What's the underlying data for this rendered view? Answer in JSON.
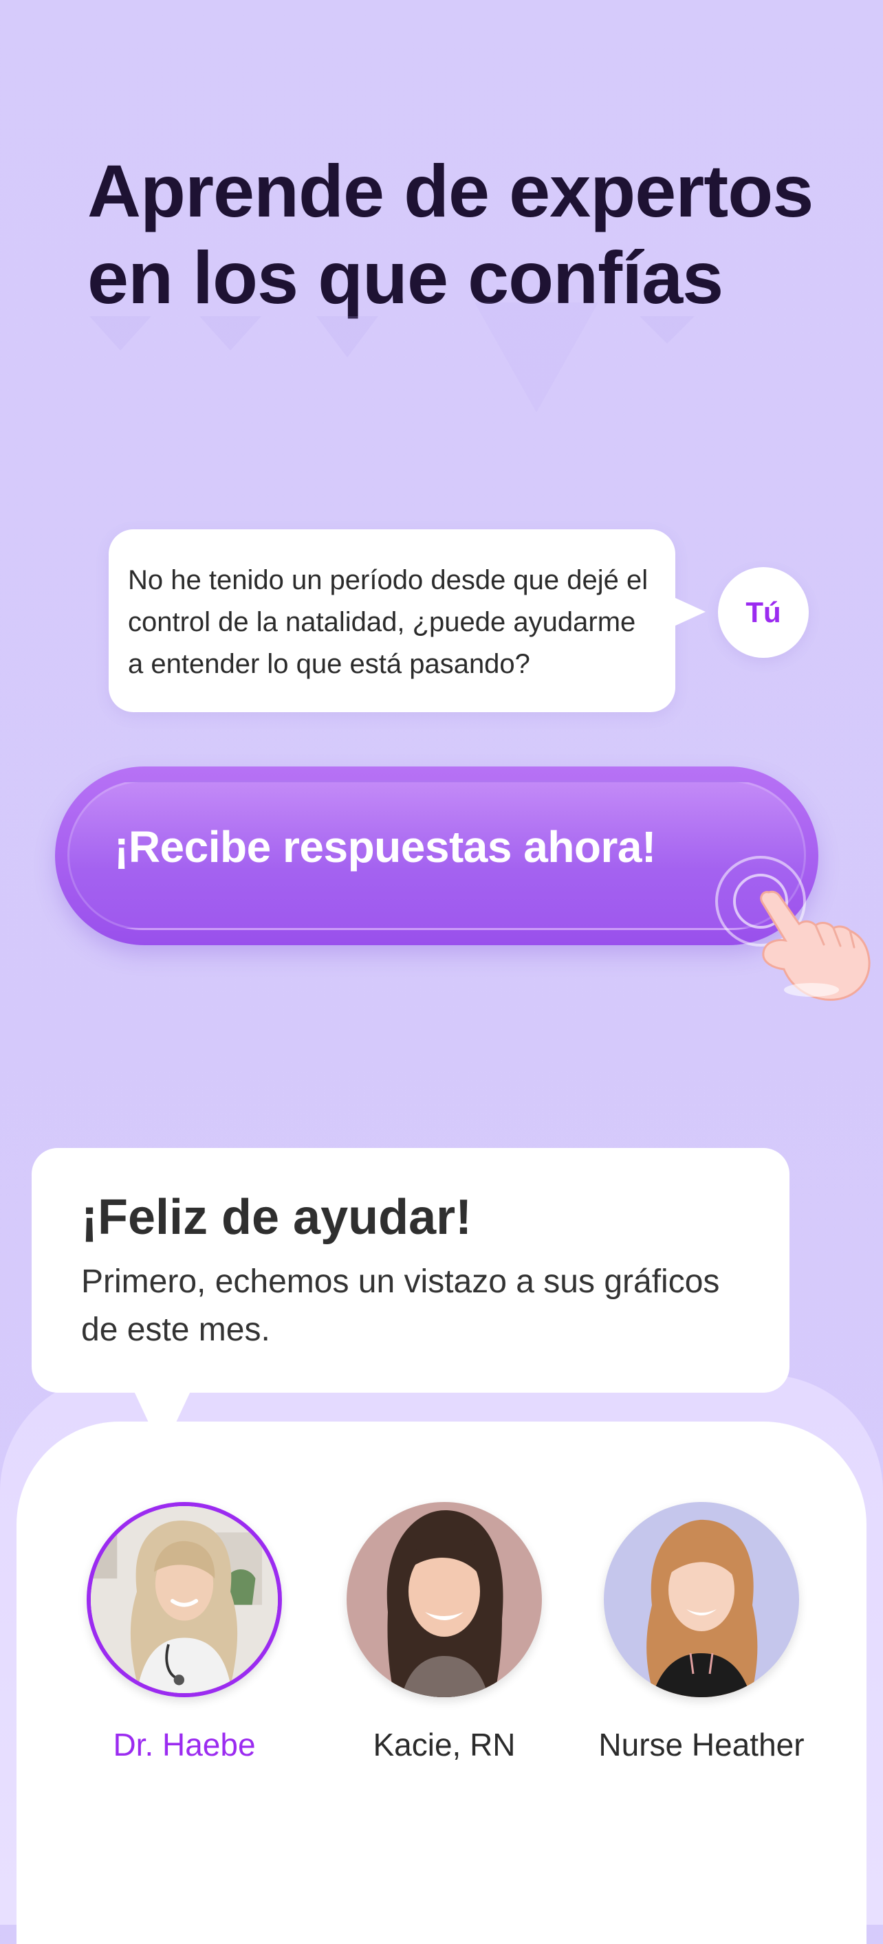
{
  "headline": {
    "line1": "Aprende de expertos",
    "line2": "en los que confías"
  },
  "user_message": {
    "text": "No he tenido un período desde que dejé el control de la natalidad, ¿puede ayudarme a entender lo que está pasando?",
    "avatar_label": "Tú"
  },
  "cta": {
    "label": "¡Recibe respuestas ahora!",
    "icon": "pointing-hand-icon"
  },
  "expert_reply": {
    "title": "¡Feliz de ayudar!",
    "subtitle": "Primero, echemos un vistazo a sus gráficos de este mes."
  },
  "experts": [
    {
      "name": "Dr. Haebe",
      "selected": true
    },
    {
      "name": "Kacie, RN",
      "selected": false
    },
    {
      "name": "Nurse Heather",
      "selected": false
    }
  ],
  "colors": {
    "background": "#d6cbfb",
    "accent": "#9b2bf0",
    "cta": "#a462f0",
    "headline": "#1e1233"
  }
}
